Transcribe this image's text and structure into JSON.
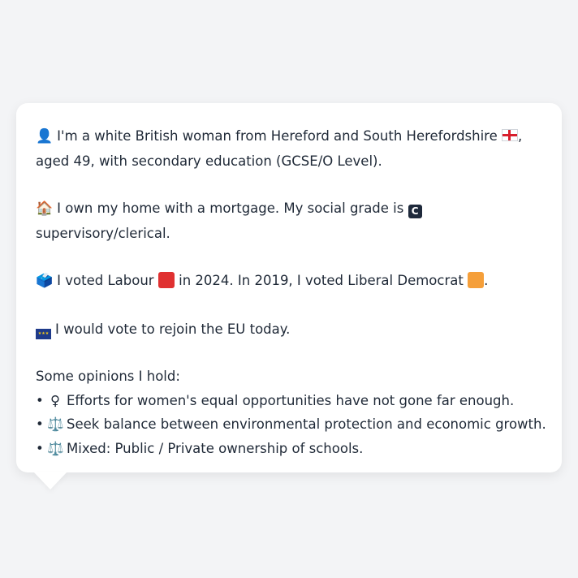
{
  "profile": {
    "intro_line1": "I'm a white British woman from Hereford and South Herefordshire",
    "intro_line1_end": ",",
    "intro_line2": "aged 49, with secondary education (GCSE/O Level).",
    "home_line1": "I own my home with a mortgage. My social grade is",
    "social_grade_badge": "C",
    "home_line2": "supervisory/clerical.",
    "vote_part1": "I voted Labour",
    "vote_part2": "in 2024. In 2019, I voted Liberal Democrat",
    "vote_part3": ".",
    "eu_line": "I would vote to rejoin the EU today."
  },
  "opinions": {
    "heading": "Some opinions I hold:",
    "items": [
      {
        "bullet": "•",
        "icon": "♀",
        "icon_name": "female-sign-icon",
        "text": "Efforts for women's equal opportunities have not gone far enough."
      },
      {
        "bullet": "•",
        "icon": "⚖️",
        "icon_name": "balance-scale-icon",
        "text": "Seek balance between environmental protection and economic growth."
      },
      {
        "bullet": "•",
        "icon": "⚖️",
        "icon_name": "balance-scale-icon",
        "text": "Mixed: Public / Private ownership of schools."
      }
    ]
  },
  "icons": {
    "person": "👤",
    "house": "🏠",
    "ballot": "🗳️",
    "eu_stars": "★★★"
  },
  "colors": {
    "labour": "#e03131",
    "libdem": "#f59f3a",
    "background": "#f3f4f6",
    "card": "#ffffff"
  }
}
